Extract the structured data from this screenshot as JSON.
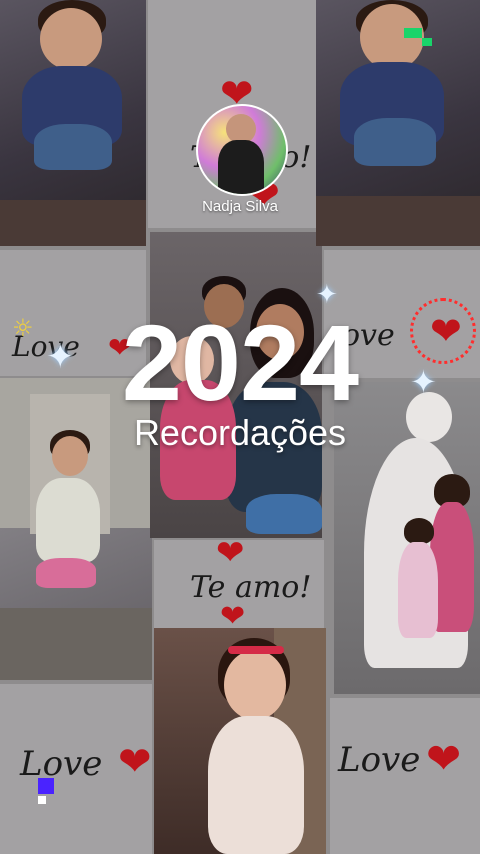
{
  "profile": {
    "name": "Nadja Silva"
  },
  "headline": {
    "year": "2024",
    "subtitle": "Recordações"
  },
  "cards": {
    "love_label": "Love",
    "te_amo_label": "Te amo!",
    "te_amo_fragment": "Te amo!",
    "love_fragment": "ove"
  },
  "colors": {
    "heart": "#c0141b",
    "title_text": "#ffffff",
    "background": "#8e8c8d",
    "sparkle": "#e6f3ff",
    "pixel_green": "#19d46a",
    "pixel_blue": "#4a23ff"
  },
  "icons": {
    "heart": "heart-icon",
    "sparkle": "sparkle-icon",
    "sun": "sun-icon"
  }
}
